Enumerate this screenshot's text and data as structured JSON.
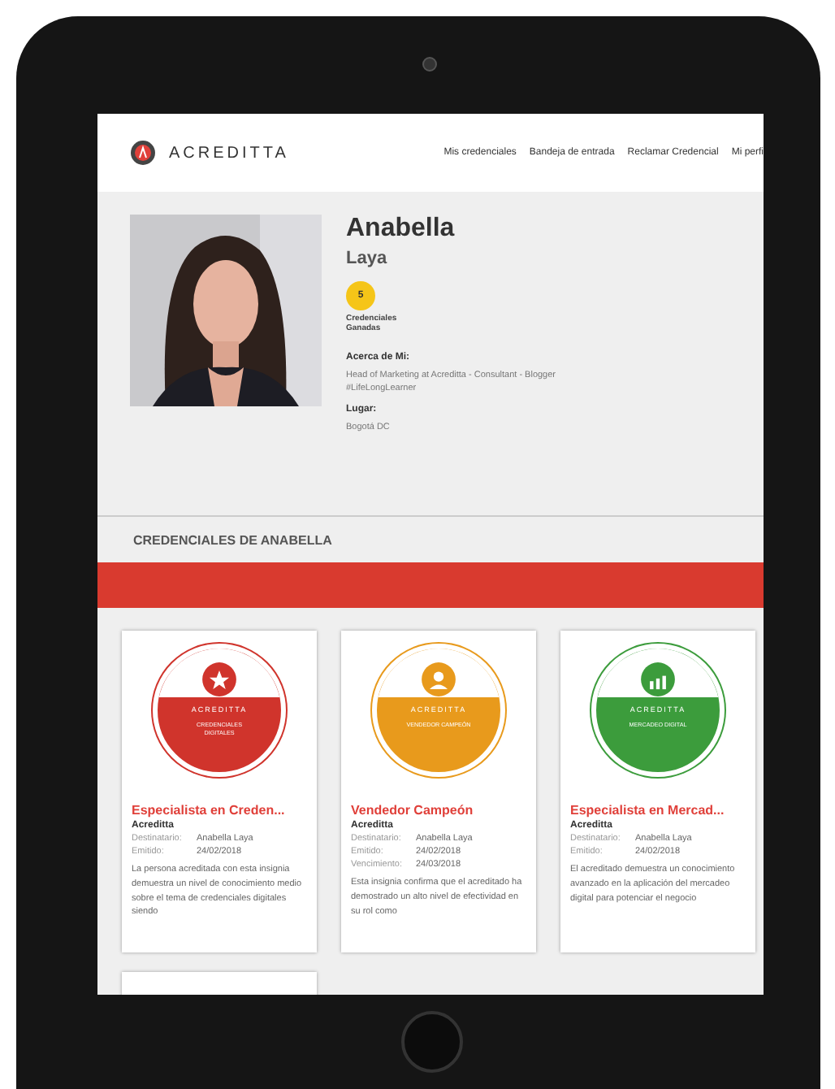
{
  "header": {
    "brand": "ACREDITTA",
    "nav": [
      {
        "label": "Mis credenciales"
      },
      {
        "label": "Bandeja de entrada"
      },
      {
        "label": "Reclamar Credencial"
      },
      {
        "label": "Mi perfi"
      }
    ]
  },
  "profile": {
    "first_name": "Anabella",
    "last_name": "Laya",
    "credential_count": "5",
    "credential_count_label": "Credenciales Ganadas",
    "about_label": "Acerca de Mi:",
    "about": "Head of Marketing at Acreditta - Consultant - Blogger #LifeLongLearner",
    "place_label": "Lugar:",
    "place": "Bogotá DC"
  },
  "section_title": "CREDENCIALES DE ANABELLA",
  "credentials": [
    {
      "title": "Especialista en Creden...",
      "issuer": "Acreditta",
      "color": "#d0342c",
      "kind": "star",
      "badge_brand": "ACREDITTA",
      "badge_label": "CREDENCIALES DIGITALES",
      "details": [
        {
          "label": "Destinatario:",
          "value": "Anabella Laya"
        },
        {
          "label": "Emitido:",
          "value": "24/02/2018"
        }
      ],
      "description": "La persona acreditada con esta insignia demuestra un nivel de conocimiento medio sobre el tema de credenciales digitales siendo"
    },
    {
      "title": "Vendedor Campeón",
      "issuer": "Acreditta",
      "color": "#e89a1c",
      "kind": "person",
      "badge_brand": "ACREDITTA",
      "badge_label": "VENDEDOR CAMPEÓN",
      "details": [
        {
          "label": "Destinatario:",
          "value": "Anabella Laya"
        },
        {
          "label": "Emitido:",
          "value": "24/02/2018"
        },
        {
          "label": "Vencimiento:",
          "value": "24/03/2018"
        }
      ],
      "description": "Esta insignia confirma que el acreditado ha demostrado un alto nivel de efectividad en su rol como"
    },
    {
      "title": "Especialista en Mercad...",
      "issuer": "Acreditta",
      "color": "#3c9c3c",
      "kind": "chart",
      "badge_brand": "ACREDITTA",
      "badge_label": "MERCADEO DIGITAL",
      "details": [
        {
          "label": "Destinatario:",
          "value": "Anabella Laya"
        },
        {
          "label": "Emitido:",
          "value": "24/02/2018"
        }
      ],
      "description": "El acreditado demuestra un conocimiento avanzado en la aplicación del mercadeo digital para potenciar el negocio"
    }
  ]
}
